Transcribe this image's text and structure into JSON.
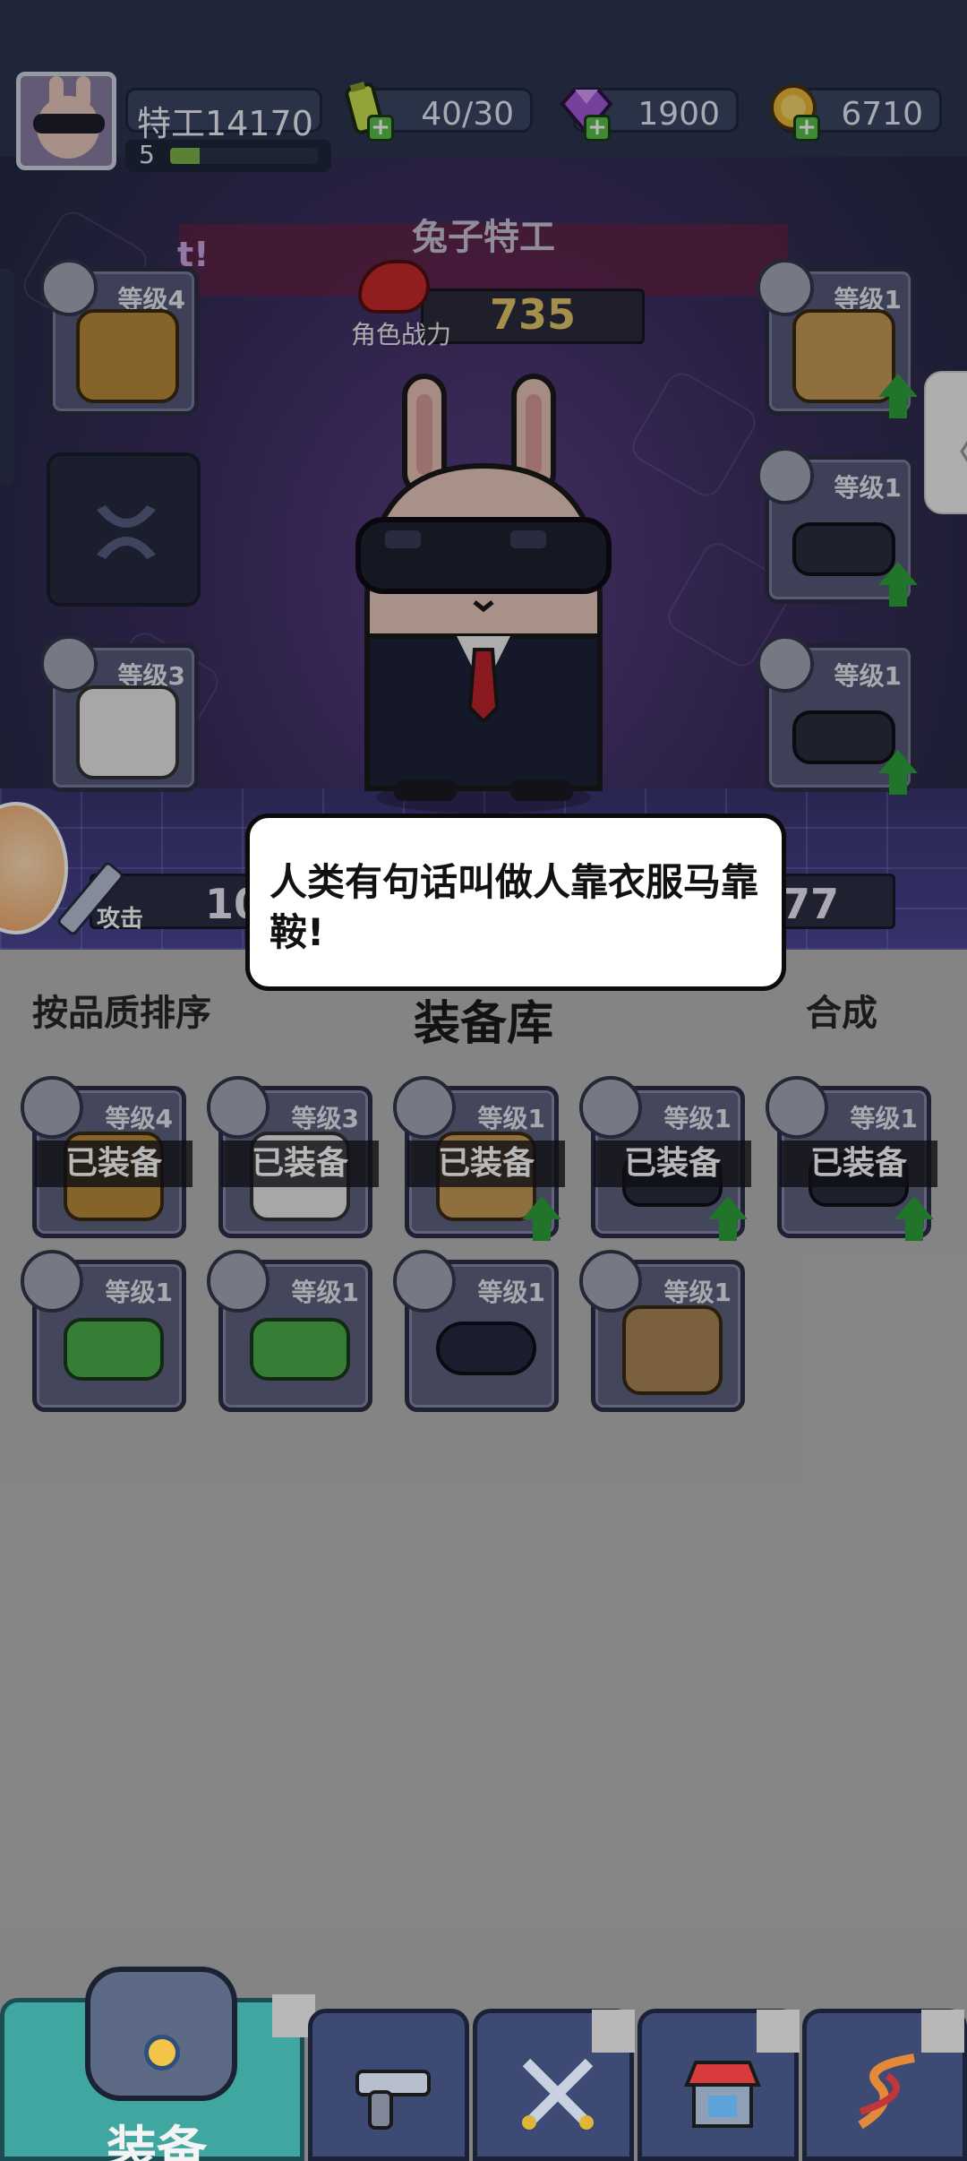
{
  "player": {
    "name": "特工14170",
    "level": "5",
    "xp_fraction": 0.2
  },
  "resources": {
    "energy": "40/30",
    "gems": "1900",
    "coins": "6710"
  },
  "character": {
    "title": "兔子特工",
    "fragment": "t!",
    "power_label": "角色战力",
    "power_value": "735"
  },
  "slots": {
    "helmet_level": "等级4",
    "armor_level": "等级1",
    "belt_level": "等级1",
    "gloves_level": "等级3",
    "shoes_level": "等级1"
  },
  "stats": {
    "attack_label": "攻击",
    "attack_value": "10",
    "right_value": "77"
  },
  "speech": {
    "text": "人类有句话叫做人靠衣服马靠鞍!"
  },
  "inventory": {
    "sort_label": "按品质排序",
    "title": "装备库",
    "merge_label": "合成",
    "equipped_label": "已装备",
    "items": [
      {
        "level": "等级4",
        "name": "helmet"
      },
      {
        "level": "等级3",
        "name": "gloves"
      },
      {
        "level": "等级1",
        "name": "armor"
      },
      {
        "level": "等级1",
        "name": "belt"
      },
      {
        "level": "等级1",
        "name": "shoes"
      },
      {
        "level": "等级1",
        "name": "green-goggles"
      },
      {
        "level": "等级1",
        "name": "green-goggles-2"
      },
      {
        "level": "等级1",
        "name": "sunglasses"
      },
      {
        "level": "等级1",
        "name": "gauntlet"
      }
    ]
  },
  "nav": {
    "equipment_label": "装备",
    "tabs": [
      "weapon-icon",
      "battle-icon",
      "shop-icon",
      "dna-icon"
    ]
  },
  "colors": {
    "accent": "#3fa6a0",
    "upgrade": "#2fa23b",
    "power": "#e4c86a"
  }
}
